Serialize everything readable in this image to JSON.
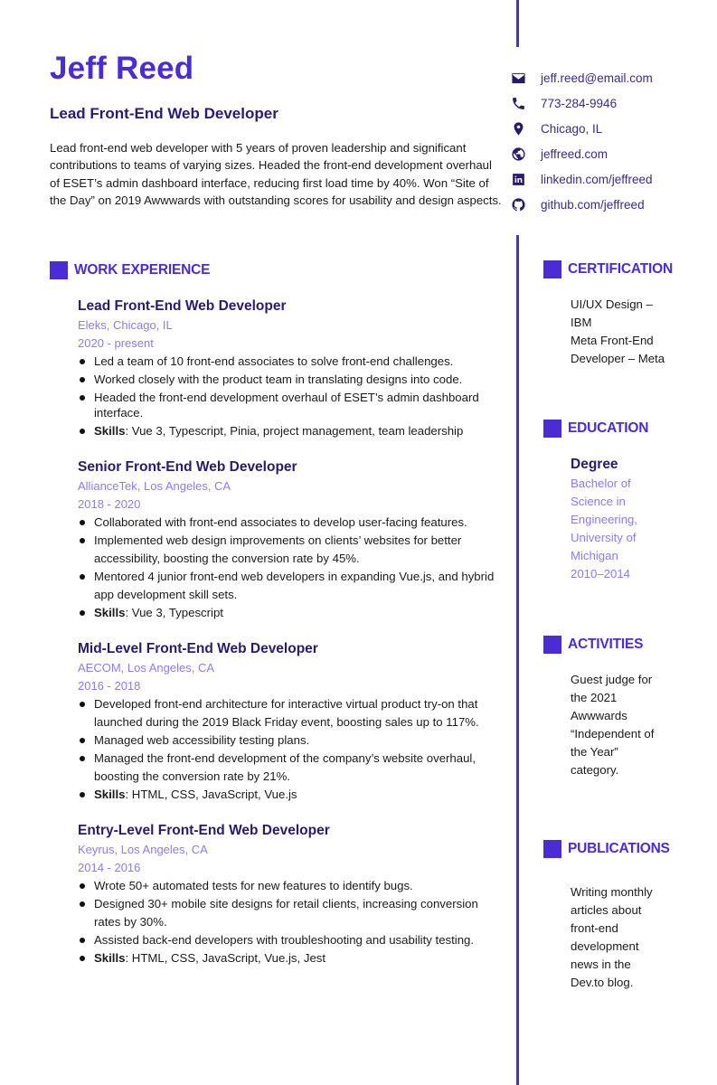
{
  "header": {
    "name": "Jeff Reed",
    "headline": "Lead Front-End Web Developer",
    "summary": "Lead front-end web developer with 5 years of proven leadership and significant contributions to teams of varying sizes. Headed the front-end development overhaul of ESET’s admin dashboard interface, reducing first load time by 40%. Won “Site of the Day” on 2019 Awwwards with outstanding scores for usability and design aspects."
  },
  "contacts": [
    {
      "icon": "email-icon",
      "text": "jeff.reed@email.com"
    },
    {
      "icon": "phone-icon",
      "text": "773-284-9946"
    },
    {
      "icon": "location-pin-icon",
      "text": "Chicago, IL"
    },
    {
      "icon": "globe-icon",
      "text": "jeffreed.com"
    },
    {
      "icon": "linkedin-icon",
      "text": "linkedin.com/jeffreed"
    },
    {
      "icon": "github-icon",
      "text": "github.com/jeffreed"
    }
  ],
  "colors": {
    "accent": "#4b2bd6",
    "title": "#2a1a6e",
    "muted": "#8c7cf2"
  },
  "work": {
    "heading": "WORK EXPERIENCE",
    "skills_label": "Skills",
    "jobs": [
      {
        "title": "Lead Front-End Web Developer",
        "company": "Eleks, Chicago, IL",
        "dates": "2020 - present",
        "bullets": [
          "Led a team of 10 front-end associates to solve front-end challenges.",
          "Worked closely with the product team in translating designs into code.",
          "Headed the front-end development overhaul of ESET’s admin dashboard interface."
        ],
        "skills": ": Vue 3, Typescript, Pinia, project management, team leadership"
      },
      {
        "title": "Senior Front-End Web Developer",
        "company": "AllianceTek, Los Angeles, CA",
        "dates": "2018 - 2020",
        "bullets": [
          "Collaborated with front-end associates to develop user-facing features.",
          "Implemented web design improvements on clients’ websites for better accessibility, boosting the conversion rate by 45%.",
          "Mentored 4 junior front-end web developers in expanding Vue.js, and hybrid app development skill sets."
        ],
        "skills": ": Vue 3, Typescript"
      },
      {
        "title": "Mid-Level Front-End Web Developer",
        "company": "AECOM, Los Angeles, CA",
        "dates": "2016 - 2018",
        "bullets": [
          "Developed front-end architecture for interactive virtual product try-on that launched during the 2019 Black Friday event, boosting sales up to 117%.",
          "Managed web accessibility testing plans.",
          "Managed the front-end development of the company’s website overhaul, boosting the conversion rate by 21%."
        ],
        "skills": ": HTML, CSS, JavaScript, Vue.js"
      },
      {
        "title": "Entry-Level Front-End Web Developer",
        "company": "Keyrus, Los Angeles, CA",
        "dates": "2014 - 2016",
        "bullets": [
          "Wrote 50+ automated tests for new features to identify bugs.",
          "Designed 30+ mobile site designs for retail clients, increasing conversion rates by 30%.",
          "Assisted back-end developers with troubleshooting and usability testing."
        ],
        "skills": ": HTML, CSS, JavaScript, Vue.js, Jest"
      }
    ]
  },
  "certification": {
    "heading": "CERTIFICATION",
    "items": [
      "UI/UX Design – IBM",
      "Meta Front-End Developer – Meta"
    ]
  },
  "education": {
    "heading": "EDUCATION",
    "degree_label": "Degree",
    "details": "Bachelor of Science in Engineering, University of Michigan",
    "dates": "2010–2014"
  },
  "activities": {
    "heading": "ACTIVITIES",
    "text": "Guest judge for the 2021 Awwwards “Independent of the Year” category."
  },
  "publications": {
    "heading": "PUBLICATIONS",
    "text": "Writing monthly articles about front-end development news in the Dev.to blog."
  }
}
